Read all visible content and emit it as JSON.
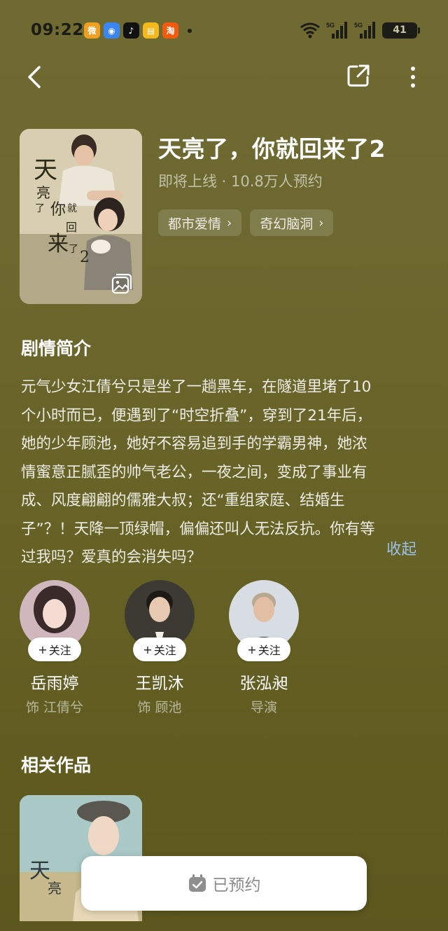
{
  "status_bar": {
    "time": "09:22",
    "app_icons": [
      {
        "name": "weibo-icon",
        "color": "#f0a020",
        "glyph": "微"
      },
      {
        "name": "browser-icon",
        "color": "#3a86f0",
        "glyph": "◉"
      },
      {
        "name": "tiktok-icon",
        "color": "#111111",
        "glyph": "♪"
      },
      {
        "name": "notes-icon",
        "color": "#f2b81e",
        "glyph": "▤"
      },
      {
        "name": "taobao-icon",
        "color": "#f45a0e",
        "glyph": "淘"
      }
    ],
    "battery": "41",
    "network_1": "5G",
    "network_2": "5G"
  },
  "drama": {
    "title": "天亮了，你就回来了2",
    "subtitle": "即将上线 · 10.8万人预约",
    "tags": [
      "都市爱情",
      "奇幻脑洞"
    ]
  },
  "synopsis": {
    "heading": "剧情简介",
    "lines": [
      "元气少女江倩兮只是坐了一趟黑车，在隧道里堵了10",
      "个小时而已，便遇到了“时空折叠”，穿到了21年后，",
      "她的少年顾池，她好不容易追到手的学霸男神，她浓",
      "情蜜意正腻歪的帅气老公，一夜之间，变成了事业有",
      "成、风度翩翩的儒雅大叔；还“重组家庭、结婚生",
      "子”？！天降一顶绿帽，偏偏还叫人无法反抗。你有等",
      "过我吗？爱真的会消失吗？"
    ],
    "collapse_label": "收起"
  },
  "cast": [
    {
      "name": "岳雨婷",
      "role": "饰 江倩兮",
      "follow_label": "关注"
    },
    {
      "name": "王凯沐",
      "role": "饰 顾池",
      "follow_label": "关注"
    },
    {
      "name": "张泓昶",
      "role": "导演",
      "follow_label": "关注"
    }
  ],
  "related": {
    "heading": "相关作品"
  },
  "reserve": {
    "label": "已预约"
  }
}
